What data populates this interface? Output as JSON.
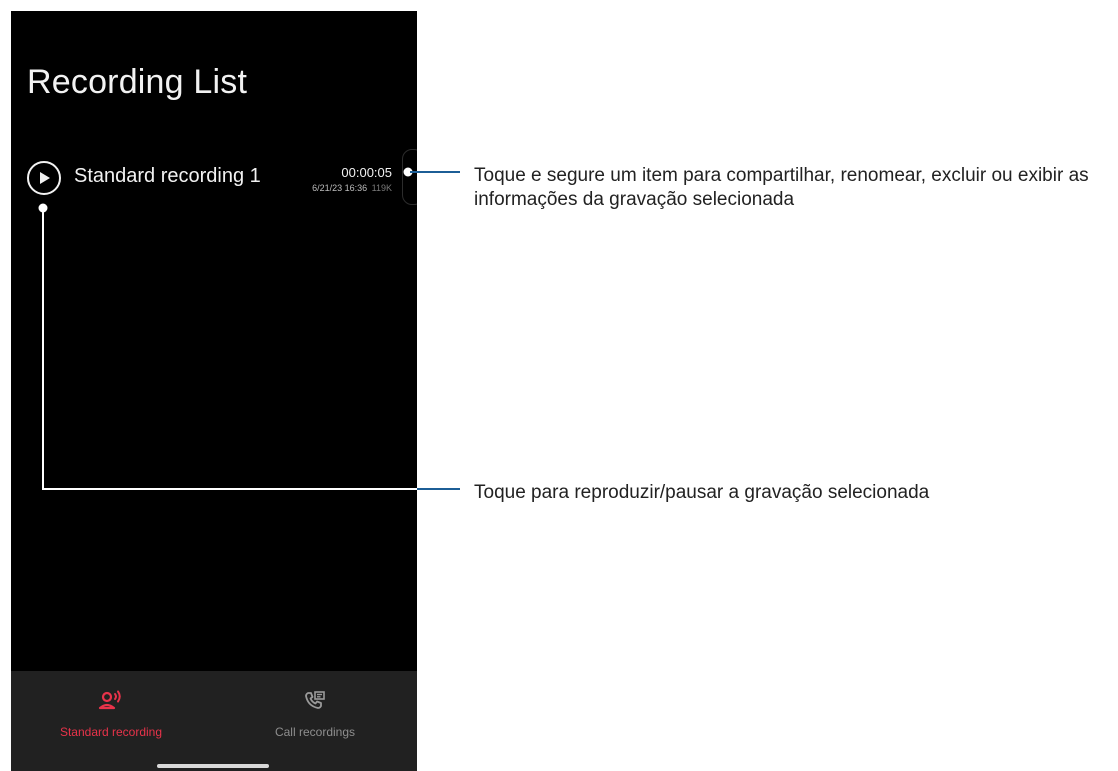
{
  "screen": {
    "title": "Recording List"
  },
  "recordings": [
    {
      "name": "Standard recording 1",
      "duration": "00:00:05",
      "date": "6/21/23 16:36",
      "size": "119K"
    }
  ],
  "bottom_nav": {
    "tabs": [
      {
        "label": "Standard recording",
        "icon": "person-speaking-icon",
        "active": true
      },
      {
        "label": "Call recordings",
        "icon": "phone-log-icon",
        "active": false
      }
    ]
  },
  "callouts": {
    "item_menu": "Toque e segure um item para compartilhar, renomear, excluir ou exibir as informações da gravação selecionada",
    "play_pause": "Toque para reproduzir/pausar a gravação selecionada"
  },
  "colors": {
    "background": "#000000",
    "nav_background": "#212121",
    "accent": "#e8334a",
    "callout_line": "#1c5e96"
  }
}
